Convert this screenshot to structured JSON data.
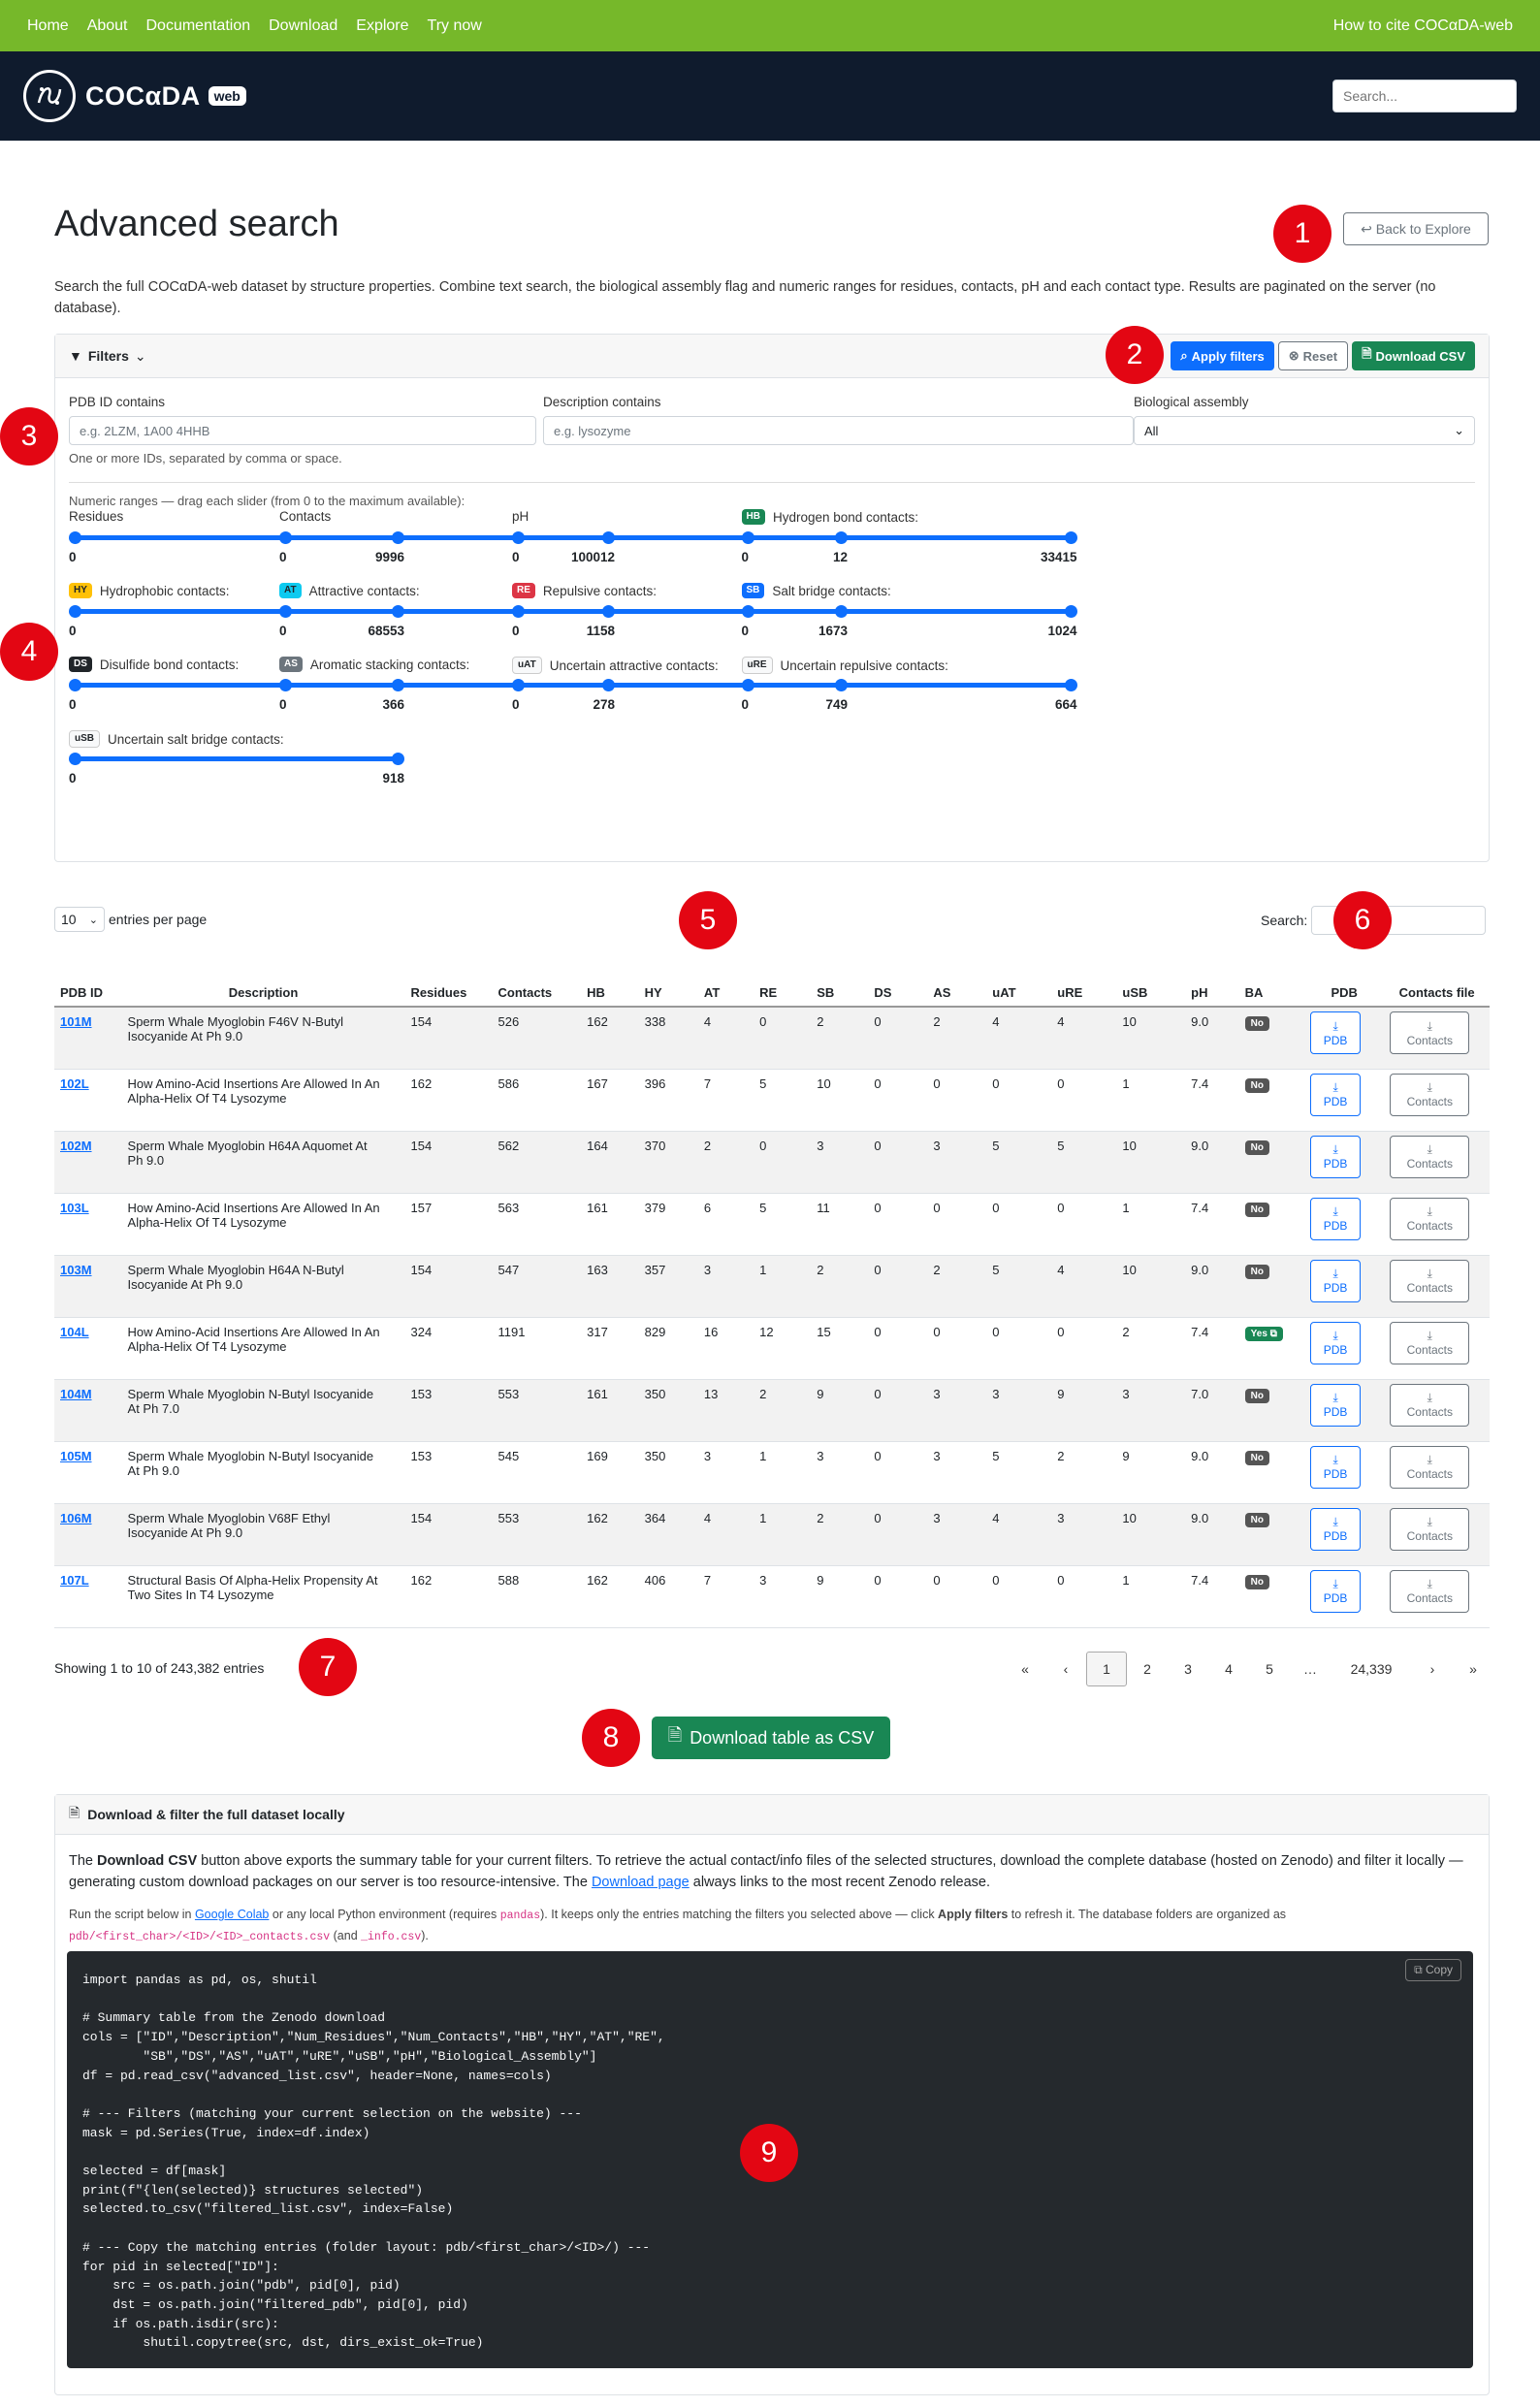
{
  "topnav": {
    "links": [
      "Home",
      "About",
      "Documentation",
      "Download",
      "Explore",
      "Try now"
    ],
    "cite": "How to cite COCαDA-web"
  },
  "brand": {
    "name": "COCαDA",
    "badge": "web",
    "search_placeholder": "Search..."
  },
  "markers": [
    "1",
    "2",
    "3",
    "4",
    "5",
    "6",
    "7",
    "8",
    "9"
  ],
  "page": {
    "title": "Advanced search",
    "back_button": "↩ Back to Explore",
    "intro": "Search the full COCαDA-web dataset by structure properties. Combine text search, the biological assembly flag and numeric ranges for residues, contacts, pH and each contact type. Results are paginated on the server (no database)."
  },
  "filters": {
    "header": "Filters",
    "apply": "Apply filters",
    "reset": "Reset",
    "download": "Download CSV",
    "pdb_label": "PDB ID contains",
    "pdb_placeholder": "e.g. 2LZM, 1A00 4HHB",
    "pdb_hint": "One or more IDs, separated by comma or space.",
    "desc_label": "Description contains",
    "desc_placeholder": "e.g. lysozyme",
    "ba_label": "Biological assembly",
    "ba_value": "All",
    "ranges_hint": "Numeric ranges — drag each slider (from 0 to the maximum available):",
    "sliders": [
      {
        "label": "Residues",
        "min": "0",
        "max": "9996",
        "badge": "",
        "color": ""
      },
      {
        "label": "Contacts",
        "min": "0",
        "max": "100012",
        "badge": "",
        "color": ""
      },
      {
        "label": "pH",
        "min": "0",
        "max": "12",
        "badge": "",
        "color": ""
      },
      {
        "label": "Hydrogen bond contacts:",
        "min": "0",
        "max": "33415",
        "badge": "HB",
        "color": "#198754"
      },
      {
        "label": "Hydrophobic contacts:",
        "min": "0",
        "max": "68553",
        "badge": "HY",
        "color": "#ffc107"
      },
      {
        "label": "Attractive contacts:",
        "min": "0",
        "max": "1158",
        "badge": "AT",
        "color": "#0dcaf0"
      },
      {
        "label": "Repulsive contacts:",
        "min": "0",
        "max": "1673",
        "badge": "RE",
        "color": "#dc3545"
      },
      {
        "label": "Salt bridge contacts:",
        "min": "0",
        "max": "1024",
        "badge": "SB",
        "color": "#0d6efd"
      },
      {
        "label": "Disulfide bond contacts:",
        "min": "0",
        "max": "366",
        "badge": "DS",
        "color": "#212529"
      },
      {
        "label": "Aromatic stacking contacts:",
        "min": "0",
        "max": "278",
        "badge": "AS",
        "color": "#6c757d"
      },
      {
        "label": "Uncertain attractive contacts:",
        "min": "0",
        "max": "749",
        "badge": "uAT",
        "color": "#f8f9fa"
      },
      {
        "label": "Uncertain repulsive contacts:",
        "min": "0",
        "max": "664",
        "badge": "uRE",
        "color": "#f8f9fa"
      },
      {
        "label": "Uncertain salt bridge contacts:",
        "min": "0",
        "max": "918",
        "badge": "uSB",
        "color": "#f8f9fa"
      }
    ]
  },
  "table": {
    "entries_value": "10",
    "entries_label": "entries per page",
    "search_label": "Search:",
    "columns": [
      "PDB ID",
      "Description",
      "Residues",
      "Contacts",
      "HB",
      "HY",
      "AT",
      "RE",
      "SB",
      "DS",
      "AS",
      "uAT",
      "uRE",
      "uSB",
      "pH",
      "BA",
      "PDB",
      "Contacts file"
    ],
    "pdb_btn": "PDB",
    "contacts_btn": "Contacts",
    "rows": [
      [
        "101M",
        "Sperm Whale Myoglobin F46V N-Butyl Isocyanide At Ph 9.0",
        "154",
        "526",
        "162",
        "338",
        "4",
        "0",
        "2",
        "0",
        "2",
        "4",
        "4",
        "10",
        "9.0",
        "No"
      ],
      [
        "102L",
        "How Amino-Acid Insertions Are Allowed In An Alpha-Helix Of T4 Lysozyme",
        "162",
        "586",
        "167",
        "396",
        "7",
        "5",
        "10",
        "0",
        "0",
        "0",
        "0",
        "1",
        "7.4",
        "No"
      ],
      [
        "102M",
        "Sperm Whale Myoglobin H64A Aquomet At Ph 9.0",
        "154",
        "562",
        "164",
        "370",
        "2",
        "0",
        "3",
        "0",
        "3",
        "5",
        "5",
        "10",
        "9.0",
        "No"
      ],
      [
        "103L",
        "How Amino-Acid Insertions Are Allowed In An Alpha-Helix Of T4 Lysozyme",
        "157",
        "563",
        "161",
        "379",
        "6",
        "5",
        "11",
        "0",
        "0",
        "0",
        "0",
        "1",
        "7.4",
        "No"
      ],
      [
        "103M",
        "Sperm Whale Myoglobin H64A N-Butyl Isocyanide At Ph 9.0",
        "154",
        "547",
        "163",
        "357",
        "3",
        "1",
        "2",
        "0",
        "2",
        "5",
        "4",
        "10",
        "9.0",
        "No"
      ],
      [
        "104L",
        "How Amino-Acid Insertions Are Allowed In An Alpha-Helix Of T4 Lysozyme",
        "324",
        "1191",
        "317",
        "829",
        "16",
        "12",
        "15",
        "0",
        "0",
        "0",
        "0",
        "2",
        "7.4",
        "Yes ⧉"
      ],
      [
        "104M",
        "Sperm Whale Myoglobin N-Butyl Isocyanide At Ph 7.0",
        "153",
        "553",
        "161",
        "350",
        "13",
        "2",
        "9",
        "0",
        "3",
        "3",
        "9",
        "3",
        "7.0",
        "No"
      ],
      [
        "105M",
        "Sperm Whale Myoglobin N-Butyl Isocyanide At Ph 9.0",
        "153",
        "545",
        "169",
        "350",
        "3",
        "1",
        "3",
        "0",
        "3",
        "5",
        "2",
        "9",
        "9.0",
        "No"
      ],
      [
        "106M",
        "Sperm Whale Myoglobin V68F Ethyl Isocyanide At Ph 9.0",
        "154",
        "553",
        "162",
        "364",
        "4",
        "1",
        "2",
        "0",
        "3",
        "4",
        "3",
        "10",
        "9.0",
        "No"
      ],
      [
        "107L",
        "Structural Basis Of Alpha-Helix Propensity At Two Sites In T4 Lysozyme",
        "162",
        "588",
        "162",
        "406",
        "7",
        "3",
        "9",
        "0",
        "0",
        "0",
        "0",
        "1",
        "7.4",
        "No"
      ]
    ],
    "info": "Showing 1 to 10 of 243,382 entries",
    "pager": [
      "«",
      "‹",
      "1",
      "2",
      "3",
      "4",
      "5",
      "…",
      "24,339",
      "›",
      "»"
    ]
  },
  "download_table_btn": "Download table as CSV",
  "download_section": {
    "header": "Download & filter the full dataset locally",
    "p1_a": "The ",
    "p1_b": "Download CSV",
    "p1_c": " button above exports the summary table for your current filters. To retrieve the actual contact/info files of the selected structures, download the complete database (hosted on Zenodo) and filter it locally — generating custom download packages on our server is too resource-intensive. The ",
    "p1_link": "Download page",
    "p1_d": " always links to the most recent Zenodo release.",
    "p2_a": "Run the script below in ",
    "p2_link": "Google Colab",
    "p2_b": " or any local Python environment (requires ",
    "p2_code1": "pandas",
    "p2_c": "). It keeps only the entries matching the filters you selected above — click ",
    "p2_bold": "Apply filters",
    "p2_d": " to refresh it. The database folders are organized as ",
    "p2_code2": "pdb/<first_char>/<ID>/<ID>_contacts.csv",
    "p2_e": " (and ",
    "p2_code3": "_info.csv",
    "p2_f": ").",
    "copy": "Copy",
    "code": "import pandas as pd, os, shutil\n\n# Summary table from the Zenodo download\ncols = [\"ID\",\"Description\",\"Num_Residues\",\"Num_Contacts\",\"HB\",\"HY\",\"AT\",\"RE\",\n        \"SB\",\"DS\",\"AS\",\"uAT\",\"uRE\",\"uSB\",\"pH\",\"Biological_Assembly\"]\ndf = pd.read_csv(\"advanced_list.csv\", header=None, names=cols)\n\n# --- Filters (matching your current selection on the website) ---\nmask = pd.Series(True, index=df.index)\n\nselected = df[mask]\nprint(f\"{len(selected)} structures selected\")\nselected.to_csv(\"filtered_list.csv\", index=False)\n\n# --- Copy the matching entries (folder layout: pdb/<first_char>/<ID>/) ---\nfor pid in selected[\"ID\"]:\n    src = os.path.join(\"pdb\", pid[0], pid)\n    dst = os.path.join(\"filtered_pdb\", pid[0], pid)\n    if os.path.isdir(src):\n        shutil.copytree(src, dst, dirs_exist_ok=True)"
  }
}
